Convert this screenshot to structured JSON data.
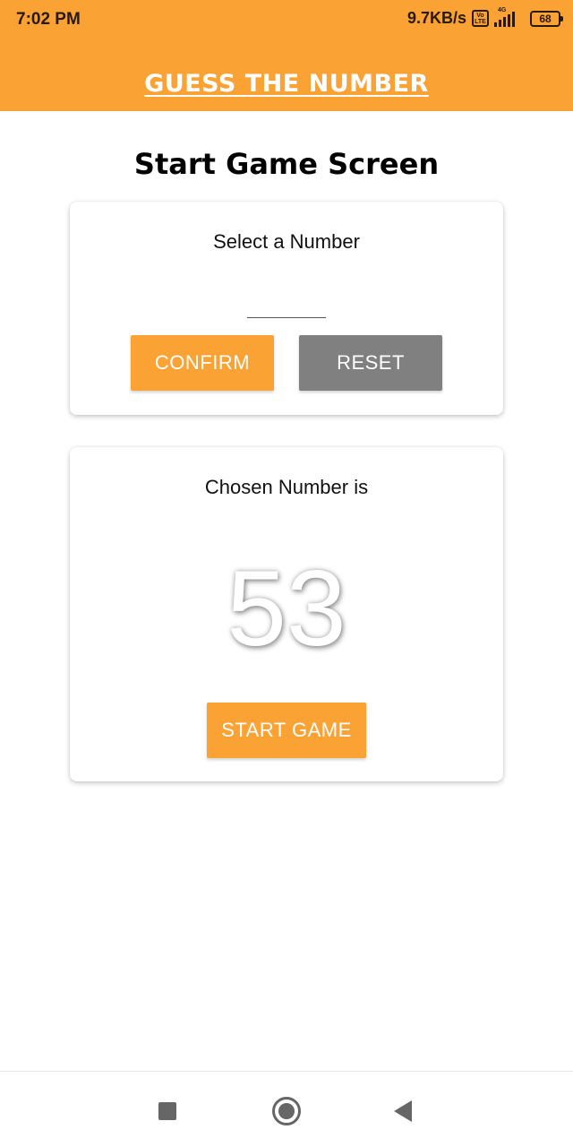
{
  "status_bar": {
    "time": "7:02 PM",
    "net_speed": "9.7KB/s",
    "volte_label": "Vo LTE",
    "network_type": "4G",
    "battery": "68"
  },
  "header": {
    "title": "GUESS THE NUMBER",
    "color": "#fba234"
  },
  "screen": {
    "title": "Start Game Screen"
  },
  "select_card": {
    "label": "Select a Number",
    "input_value": "",
    "confirm_label": "CONFIRM",
    "reset_label": "RESET"
  },
  "chosen_card": {
    "label": "Chosen Number is",
    "number": "53",
    "start_label": "START GAME"
  },
  "colors": {
    "accent": "#fba234",
    "reset": "#808080"
  },
  "nav": {
    "icons": [
      "recent-apps-icon",
      "home-icon",
      "back-icon"
    ]
  }
}
